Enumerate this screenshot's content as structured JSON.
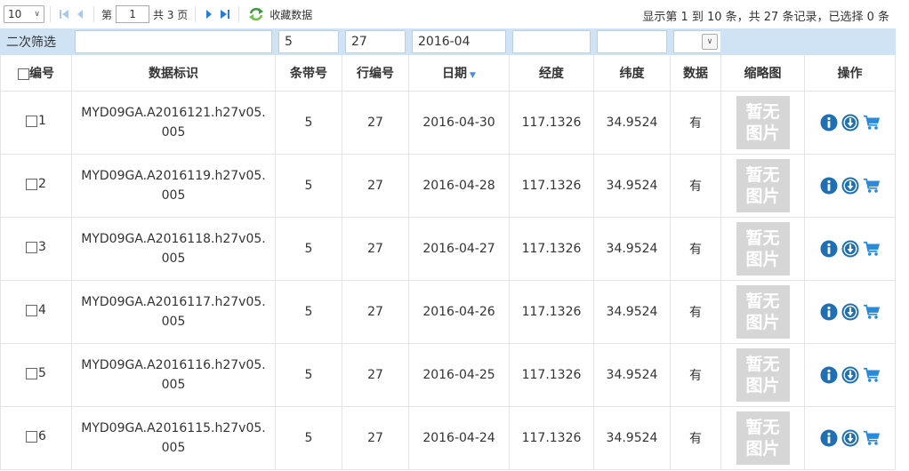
{
  "toolbar": {
    "page_size": "10",
    "page_prefix": "第",
    "current_page": "1",
    "total_pages_label": "共 3 页",
    "favorites_label": "收藏数据",
    "page_info": "显示第 1 到 10 条，共 27 条记录，已选择 0 条"
  },
  "filter": {
    "label": "二次筛选",
    "dataset_id": "",
    "path": "5",
    "row": "27",
    "date": "2016-04",
    "longitude": "",
    "latitude": "",
    "data_available": ""
  },
  "columns": {
    "number": "编号",
    "dataset_id": "数据标识",
    "path": "条带号",
    "row": "行编号",
    "date": "日期",
    "longitude": "经度",
    "latitude": "纬度",
    "data": "数据",
    "thumbnail": "缩略图",
    "actions": "操作"
  },
  "thumbnail_placeholder": {
    "line1": "暂无",
    "line2": "图片"
  },
  "rows": [
    {
      "no": "1",
      "id": "MYD09GA.A2016121.h27v05.005",
      "path": "5",
      "row": "27",
      "date": "2016-04-30",
      "lon": "117.1326",
      "lat": "34.9524",
      "data": "有"
    },
    {
      "no": "2",
      "id": "MYD09GA.A2016119.h27v05.005",
      "path": "5",
      "row": "27",
      "date": "2016-04-28",
      "lon": "117.1326",
      "lat": "34.9524",
      "data": "有"
    },
    {
      "no": "3",
      "id": "MYD09GA.A2016118.h27v05.005",
      "path": "5",
      "row": "27",
      "date": "2016-04-27",
      "lon": "117.1326",
      "lat": "34.9524",
      "data": "有"
    },
    {
      "no": "4",
      "id": "MYD09GA.A2016117.h27v05.005",
      "path": "5",
      "row": "27",
      "date": "2016-04-26",
      "lon": "117.1326",
      "lat": "34.9524",
      "data": "有"
    },
    {
      "no": "5",
      "id": "MYD09GA.A2016116.h27v05.005",
      "path": "5",
      "row": "27",
      "date": "2016-04-25",
      "lon": "117.1326",
      "lat": "34.9524",
      "data": "有"
    },
    {
      "no": "6",
      "id": "MYD09GA.A2016115.h27v05.005",
      "path": "5",
      "row": "27",
      "date": "2016-04-24",
      "lon": "117.1326",
      "lat": "34.9524",
      "data": "有"
    }
  ],
  "colors": {
    "filter_bg": "#cfe3f5",
    "icon_blue": "#1f6fb2",
    "cart_blue": "#2b8ad8",
    "nav_blue": "#2b7bd6",
    "nav_disabled": "#a9c8ea",
    "refresh_green": "#3a9a3a"
  }
}
